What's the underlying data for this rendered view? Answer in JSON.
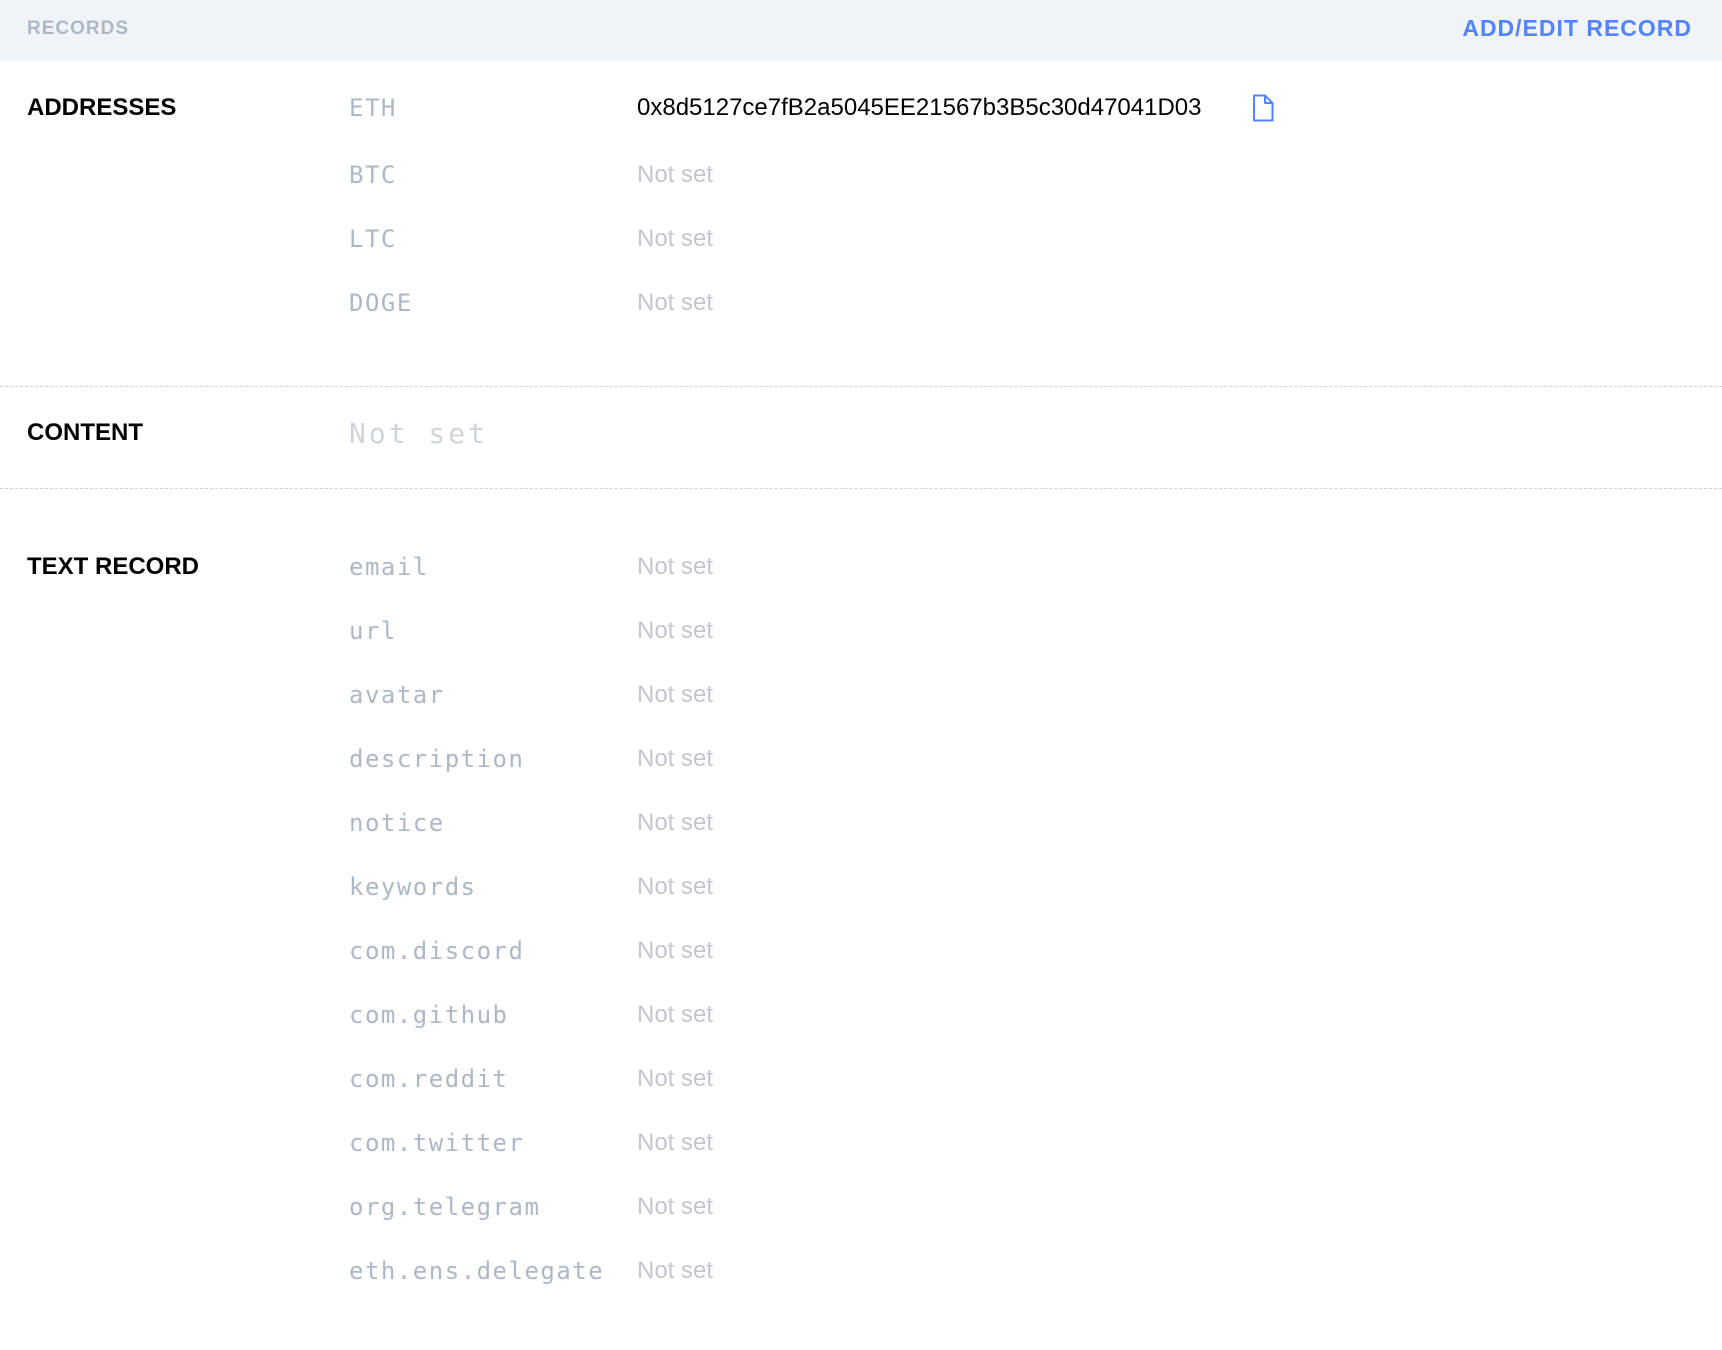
{
  "header": {
    "title": "RECORDS",
    "action_label": "ADD/EDIT RECORD"
  },
  "addresses": {
    "title": "ADDRESSES",
    "rows": [
      {
        "key": "ETH",
        "value": "0x8d5127ce7fB2a5045EE21567b3B5c30d47041D03"
      },
      {
        "key": "BTC",
        "value": "Not set"
      },
      {
        "key": "LTC",
        "value": "Not set"
      },
      {
        "key": "DOGE",
        "value": "Not set"
      }
    ]
  },
  "content": {
    "title": "CONTENT",
    "value": "Not set"
  },
  "text_record": {
    "title": "TEXT RECORD",
    "rows": [
      {
        "key": "email",
        "value": "Not set"
      },
      {
        "key": "url",
        "value": "Not set"
      },
      {
        "key": "avatar",
        "value": "Not set"
      },
      {
        "key": "description",
        "value": "Not set"
      },
      {
        "key": "notice",
        "value": "Not set"
      },
      {
        "key": "keywords",
        "value": "Not set"
      },
      {
        "key": "com.discord",
        "value": "Not set"
      },
      {
        "key": "com.github",
        "value": "Not set"
      },
      {
        "key": "com.reddit",
        "value": "Not set"
      },
      {
        "key": "com.twitter",
        "value": "Not set"
      },
      {
        "key": "org.telegram",
        "value": "Not set"
      },
      {
        "key": "eth.ens.delegate",
        "value": "Not set"
      }
    ]
  },
  "icons": {
    "copy": "copy-icon"
  },
  "colors": {
    "accent": "#5284ff",
    "header_bg": "#f0f4f8",
    "key_text": "#adb8c7",
    "unset_text": "#c2c7cf"
  }
}
